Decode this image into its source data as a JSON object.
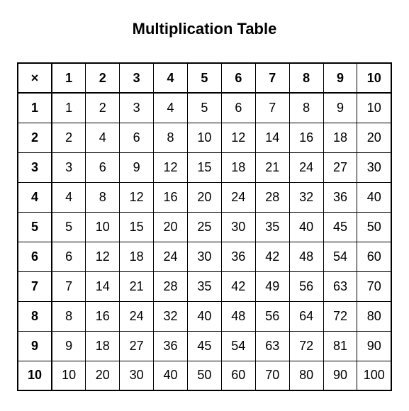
{
  "title": "Multiplication Table",
  "chart_data": {
    "type": "table",
    "title": "Multiplication Table",
    "corner_label": "×",
    "column_headers": [
      1,
      2,
      3,
      4,
      5,
      6,
      7,
      8,
      9,
      10
    ],
    "row_headers": [
      1,
      2,
      3,
      4,
      5,
      6,
      7,
      8,
      9,
      10
    ],
    "rows": [
      [
        1,
        2,
        3,
        4,
        5,
        6,
        7,
        8,
        9,
        10
      ],
      [
        2,
        4,
        6,
        8,
        10,
        12,
        14,
        16,
        18,
        20
      ],
      [
        3,
        6,
        9,
        12,
        15,
        18,
        21,
        24,
        27,
        30
      ],
      [
        4,
        8,
        12,
        16,
        20,
        24,
        28,
        32,
        36,
        40
      ],
      [
        5,
        10,
        15,
        20,
        25,
        30,
        35,
        40,
        45,
        50
      ],
      [
        6,
        12,
        18,
        24,
        30,
        36,
        42,
        48,
        54,
        60
      ],
      [
        7,
        14,
        21,
        28,
        35,
        42,
        49,
        56,
        63,
        70
      ],
      [
        8,
        16,
        24,
        32,
        40,
        48,
        56,
        64,
        72,
        80
      ],
      [
        9,
        18,
        27,
        36,
        45,
        54,
        63,
        72,
        81,
        90
      ],
      [
        10,
        20,
        30,
        40,
        50,
        60,
        70,
        80,
        90,
        100
      ]
    ]
  }
}
